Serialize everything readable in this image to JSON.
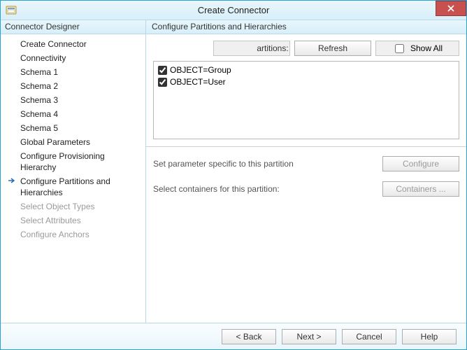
{
  "window": {
    "title": "Create Connector"
  },
  "sidebar": {
    "header": "Connector Designer",
    "items": [
      {
        "label": "Create Connector",
        "disabled": false,
        "selected": false
      },
      {
        "label": "Connectivity",
        "disabled": false,
        "selected": false
      },
      {
        "label": "Schema 1",
        "disabled": false,
        "selected": false
      },
      {
        "label": "Schema 2",
        "disabled": false,
        "selected": false
      },
      {
        "label": "Schema 3",
        "disabled": false,
        "selected": false
      },
      {
        "label": "Schema 4",
        "disabled": false,
        "selected": false
      },
      {
        "label": "Schema 5",
        "disabled": false,
        "selected": false
      },
      {
        "label": "Global Parameters",
        "disabled": false,
        "selected": false
      },
      {
        "label": "Configure Provisioning Hierarchy",
        "disabled": false,
        "selected": false
      },
      {
        "label": "Configure Partitions and Hierarchies",
        "disabled": false,
        "selected": true
      },
      {
        "label": "Select Object Types",
        "disabled": true,
        "selected": false
      },
      {
        "label": "Select Attributes",
        "disabled": true,
        "selected": false
      },
      {
        "label": "Configure Anchors",
        "disabled": true,
        "selected": false
      }
    ]
  },
  "main": {
    "header": "Configure Partitions and Hierarchies",
    "toolbar": {
      "partitions_label": "artitions:",
      "refresh_label": "Refresh",
      "showall_label": "Show All",
      "showall_checked": false
    },
    "list": [
      {
        "label": "OBJECT=Group",
        "checked": true
      },
      {
        "label": "OBJECT=User",
        "checked": true
      }
    ],
    "params": {
      "row1_label": "Set parameter specific to this partition",
      "row1_button": "Configure",
      "row2_label": "Select containers for this partition:",
      "row2_button": "Containers ..."
    }
  },
  "footer": {
    "back": "<  Back",
    "next": "Next  >",
    "cancel": "Cancel",
    "help": "Help"
  }
}
